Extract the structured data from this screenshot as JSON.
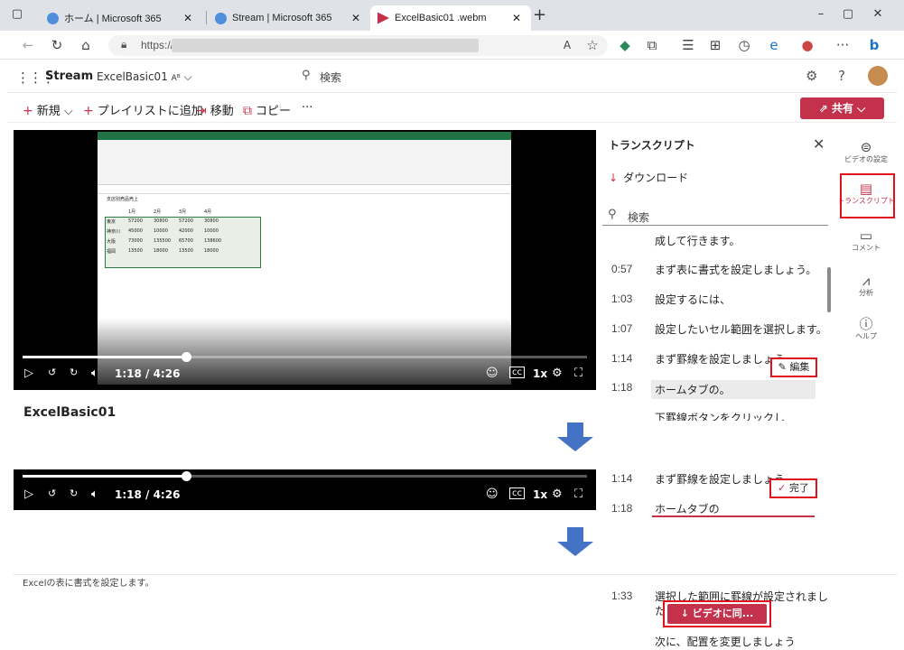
{
  "browser": {
    "tabs": [
      {
        "title": "ホーム | Microsoft 365",
        "favicon_color": "#4f8edb"
      },
      {
        "title": "Stream | Microsoft 365",
        "favicon_color": "#4f8edb"
      },
      {
        "title": "ExcelBasic01 .webm",
        "favicon_color": "#c4314b"
      }
    ],
    "url_prefix": "https://",
    "icons": [
      "back-icon",
      "refresh-icon",
      "home-icon",
      "lock-icon",
      "read-aloud-icon",
      "favorites-icon",
      "copilot-icon",
      "extensions-icon",
      "collections-icon",
      "history-icon",
      "edge-icon",
      "profile-icon",
      "more-icon",
      "bing-icon"
    ]
  },
  "stream": {
    "app_name": "Stream",
    "file_name": "ExcelBasic01",
    "search_placeholder": "検索",
    "commands": {
      "new": "新規",
      "add_to_playlist": "プレイリストに追加",
      "move": "移動",
      "copy": "コピー",
      "more": "···",
      "share": "共有"
    }
  },
  "video": {
    "current_time": "1:18",
    "duration": "4:26",
    "time_label": "1:18 / 4:26",
    "progress_fraction": 0.29,
    "speed": "1x",
    "title": "ExcelBasic01",
    "excel_cells": [
      [
        "支店別売品売上"
      ],
      [
        "",
        "1月",
        "2月",
        "3月",
        "4月"
      ],
      [
        "東京",
        "57200",
        "30800",
        "57200",
        "30800"
      ],
      [
        "神奈川",
        "45000",
        "10000",
        "42000",
        "10000"
      ],
      [
        "大阪",
        "73000",
        "135500",
        "65700",
        "138600"
      ],
      [
        "福岡",
        "13500",
        "18000",
        "13500",
        "18000"
      ]
    ]
  },
  "transcript": {
    "title": "トランスクリプト",
    "download": "ダウンロード",
    "search_placeholder": "検索",
    "partial_top": "成して行きます。",
    "lines": [
      {
        "time": "0:57",
        "text": "まず表に書式を設定しましょう。"
      },
      {
        "time": "1:03",
        "text": "設定するには、"
      },
      {
        "time": "1:07",
        "text": "設定したいセル範囲を選択します。"
      },
      {
        "time": "1:14",
        "text": "まず罫線を設定しましょう"
      },
      {
        "time": "1:18",
        "text": "ホームタブの。"
      }
    ],
    "partial_bottom": "下罫線ボタンをクリックし",
    "edit_label": "編集"
  },
  "rail": [
    {
      "label": "ビデオの設定",
      "icon": "settings-icon"
    },
    {
      "label": "トランスクリプト",
      "icon": "transcript-icon"
    },
    {
      "label": "コメント",
      "icon": "comment-icon"
    },
    {
      "label": "分析",
      "icon": "analytics-icon"
    },
    {
      "label": "ヘルプ",
      "icon": "help-icon"
    }
  ],
  "step2": {
    "time_label": "1:18 / 4:26",
    "speed": "1x",
    "line1": {
      "time": "1:14",
      "text": "まず罫線を設定しましょう"
    },
    "line2": {
      "time": "1:18",
      "text": "ホームタブの"
    },
    "done_label": "完了"
  },
  "step3": {
    "description": "Excelの表に書式を設定します。",
    "line": {
      "time": "1:33",
      "text": "選択した範囲に罫線が設定されまし",
      "text2": "た"
    },
    "goto_label": "ビデオに同...",
    "partial_bottom": "次に、配置を変更しましょう"
  },
  "colors": {
    "accent": "#c4314b",
    "highlight_box": "#e0111c",
    "arrow": "#4472c4"
  }
}
